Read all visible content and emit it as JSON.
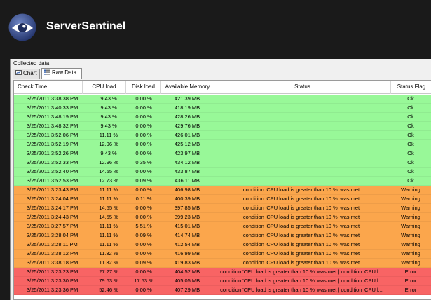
{
  "app": {
    "title": "ServerSentinel"
  },
  "panel": {
    "group_label": "Collected data"
  },
  "tabs": [
    {
      "label": "Chart",
      "icon": "chart-icon"
    },
    {
      "label": "Raw Data",
      "icon": "list-icon",
      "active": true
    }
  ],
  "table": {
    "columns": [
      "Check Time",
      "CPU load",
      "Disk load",
      "Available Memory",
      "Status",
      "Status Flag"
    ],
    "row_colors": {
      "Ok": "#98f898",
      "Warning": "#fba64c",
      "Error": "#f86464"
    },
    "rows": [
      [
        "3/25/2011 3:38:38 PM",
        "9.43 %",
        "0.00 %",
        "421.39 MB",
        "",
        "Ok"
      ],
      [
        "3/25/2011 3:40:33 PM",
        "9.43 %",
        "0.00 %",
        "418.19 MB",
        "",
        "Ok"
      ],
      [
        "3/25/2011 3:48:19 PM",
        "9.43 %",
        "0.00 %",
        "428.26 MB",
        "",
        "Ok"
      ],
      [
        "3/25/2011 3:48:32 PM",
        "9.43 %",
        "0.00 %",
        "429.76 MB",
        "",
        "Ok"
      ],
      [
        "3/25/2011 3:52:06 PM",
        "11.11 %",
        "0.00 %",
        "426.01 MB",
        "",
        "Ok"
      ],
      [
        "3/25/2011 3:52:19 PM",
        "12.96 %",
        "0.00 %",
        "425.12 MB",
        "",
        "Ok"
      ],
      [
        "3/25/2011 3:52:26 PM",
        "9.43 %",
        "0.00 %",
        "423.97 MB",
        "",
        "Ok"
      ],
      [
        "3/25/2011 3:52:33 PM",
        "12.96 %",
        "0.35 %",
        "434.12 MB",
        "",
        "Ok"
      ],
      [
        "3/25/2011 3:52:40 PM",
        "14.55 %",
        "0.00 %",
        "433.87 MB",
        "",
        "Ok"
      ],
      [
        "3/25/2011 3:52:53 PM",
        "12.73 %",
        "0.09 %",
        "436.11 MB",
        "",
        "Ok"
      ],
      [
        "3/25/2011 3:23:43 PM",
        "11.11 %",
        "0.00 %",
        "406.98 MB",
        "condition 'CPU load is greater than 10 %' was met",
        "Warning"
      ],
      [
        "3/25/2011 3:24:04 PM",
        "11.11 %",
        "0.11 %",
        "400.39 MB",
        "condition 'CPU load is greater than 10 %' was met",
        "Warning"
      ],
      [
        "3/25/2011 3:24:17 PM",
        "14.55 %",
        "0.00 %",
        "397.85 MB",
        "condition 'CPU load is greater than 10 %' was met",
        "Warning"
      ],
      [
        "3/25/2011 3:24:43 PM",
        "14.55 %",
        "0.00 %",
        "399.23 MB",
        "condition 'CPU load is greater than 10 %' was met",
        "Warning"
      ],
      [
        "3/25/2011 3:27:57 PM",
        "11.11 %",
        "5.51 %",
        "415.01 MB",
        "condition 'CPU load is greater than 10 %' was met",
        "Warning"
      ],
      [
        "3/25/2011 3:28:04 PM",
        "11.11 %",
        "0.09 %",
        "414.74 MB",
        "condition 'CPU load is greater than 10 %' was met",
        "Warning"
      ],
      [
        "3/25/2011 3:28:11 PM",
        "11.11 %",
        "0.00 %",
        "412.54 MB",
        "condition 'CPU load is greater than 10 %' was met",
        "Warning"
      ],
      [
        "3/25/2011 3:38:12 PM",
        "11.32 %",
        "0.00 %",
        "416.99 MB",
        "condition 'CPU load is greater than 10 %' was met",
        "Warning"
      ],
      [
        "3/25/2011 3:38:18 PM",
        "11.32 %",
        "0.09 %",
        "419.83 MB",
        "condition 'CPU load is greater than 10 %' was met",
        "Warning"
      ],
      [
        "3/25/2011 3:23:23 PM",
        "27.27 %",
        "0.00 %",
        "404.52 MB",
        "condition 'CPU load is greater than 10 %' was met | condition 'CPU l...",
        "Error"
      ],
      [
        "3/25/2011 3:23:30 PM",
        "79.63 %",
        "17.53 %",
        "405.05 MB",
        "condition 'CPU load is greater than 10 %' was met | condition 'CPU l...",
        "Error"
      ],
      [
        "3/25/2011 3:23:36 PM",
        "52.46 %",
        "0.00 %",
        "407.29 MB",
        "condition 'CPU load is greater than 10 %' was met | condition 'CPU l...",
        "Error"
      ]
    ]
  }
}
